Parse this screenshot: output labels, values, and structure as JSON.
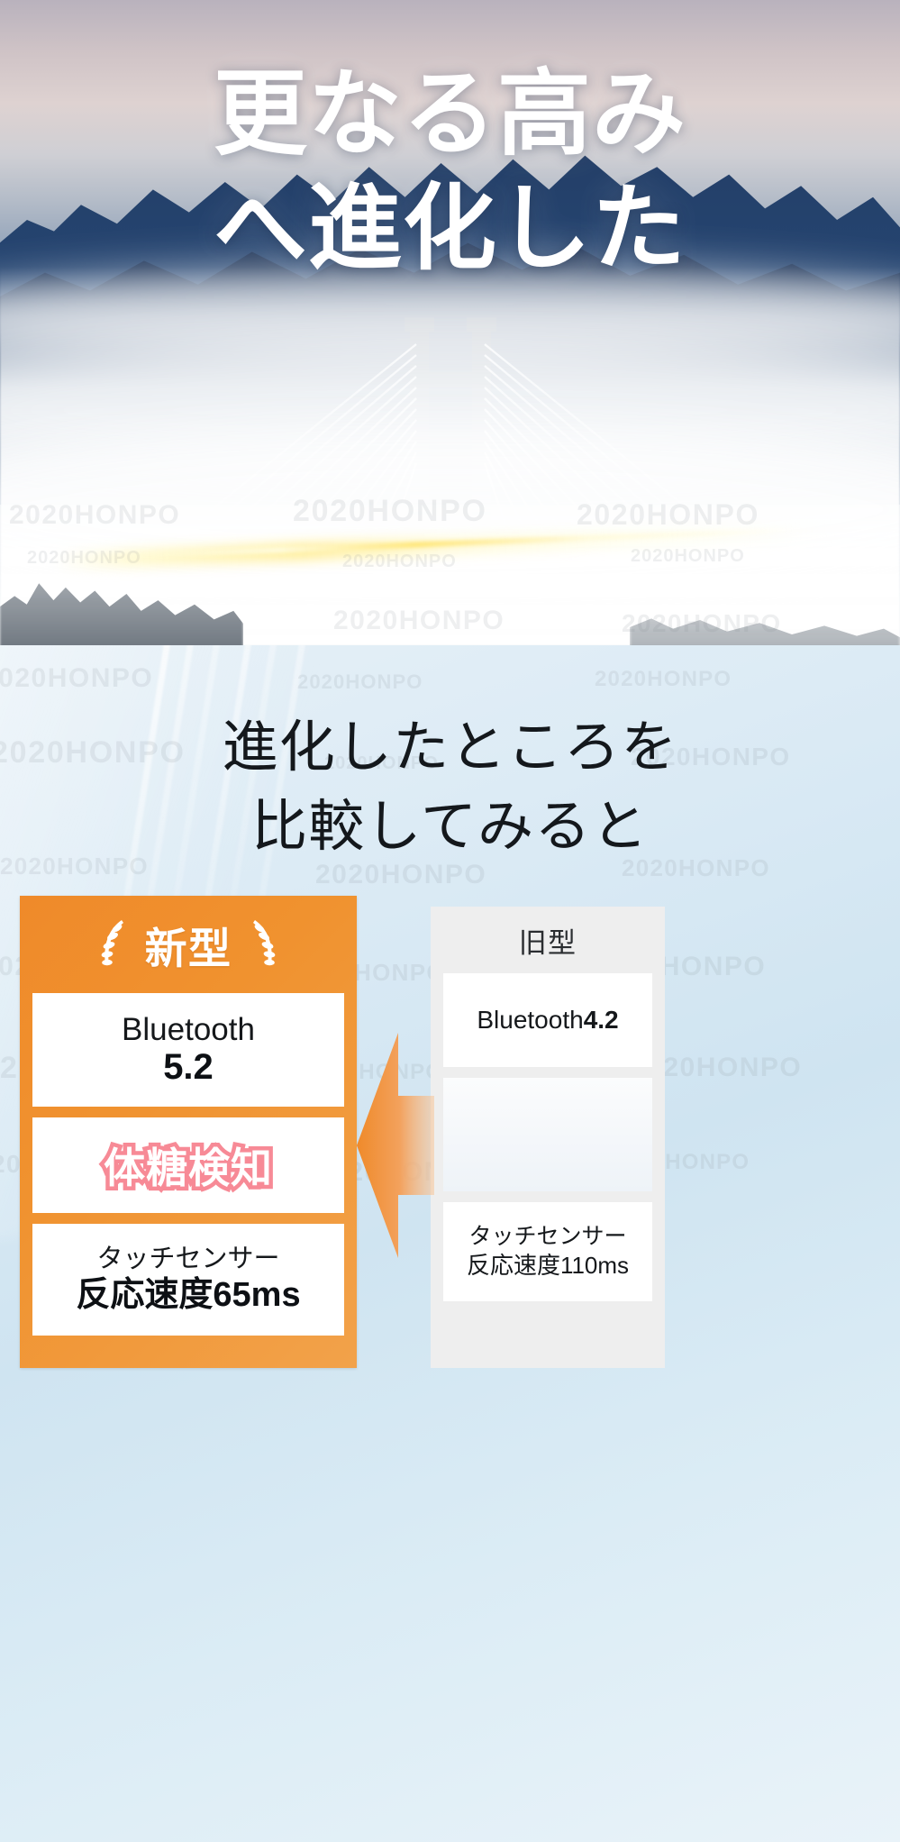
{
  "hero": {
    "title_line1": "更なる高み",
    "title_line2": "へ進化した",
    "watermark_text": "2020HONPO"
  },
  "lower": {
    "heading_line1": "進化したところを",
    "heading_line2": "比較してみると"
  },
  "comparison": {
    "new_card": {
      "badge_label": "新型",
      "laurel_left_icon": "laurel-wreath-left-icon",
      "laurel_right_icon": "laurel-wreath-right-icon",
      "accent_color": "#f0922f",
      "rows": [
        {
          "line1": "Bluetooth",
          "line2": "5.2"
        },
        {
          "highlight": "体糖検知",
          "highlight_color": "#f78a96"
        },
        {
          "line1": "タッチセンサー",
          "line2": "反応速度65ms"
        }
      ]
    },
    "old_card": {
      "badge_label": "旧型",
      "background_color": "#eeeeee",
      "rows": [
        {
          "text_plain": "Bluetooth",
          "text_bold": "4.2"
        },
        {
          "blank": true
        },
        {
          "line1": "タッチセンサー",
          "line2": "反応速度110ms"
        }
      ]
    },
    "arrow": {
      "icon": "left-arrow-icon",
      "color": "#f0922f"
    }
  }
}
